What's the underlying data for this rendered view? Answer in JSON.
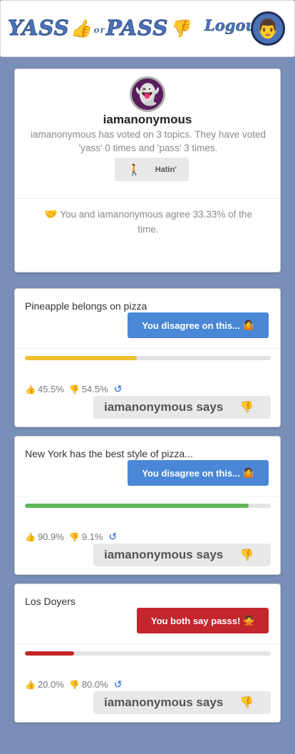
{
  "header": {
    "logo": {
      "part1": "YASS",
      "thumb_up": "👍",
      "or": "or",
      "part2": "PASS",
      "thumb_down": "👎"
    },
    "logout_label": "Logout",
    "avatar_emoji": "👨"
  },
  "profile": {
    "avatar_emoji": "👻",
    "username": "iamanonymous",
    "summary": "iamanonymous has voted on 3 topics. They have voted 'yass' 0 times and 'pass' 3 times.",
    "badge_emoji": "🚶",
    "badge_label": "Hatin'",
    "agreement_icon": "🤝",
    "agreement_text": "You and iamanonymous agree 33.33% of the time."
  },
  "topics": [
    {
      "title": "Pineapple belongs on pizza",
      "status_label": "You disagree on this...",
      "status_emoji": "🤷",
      "status_color": "#4a87d6",
      "yass_percent": "45.5%",
      "pass_percent": "54.5%",
      "yass_fraction": 0.455,
      "bar_color": "#f0bf2e",
      "says_label": "iamanonymous says",
      "says_vote_icon": "👎"
    },
    {
      "title": "New York has the best style of pizza...",
      "status_label": "You disagree on this...",
      "status_emoji": "🤷",
      "status_color": "#4a87d6",
      "yass_percent": "90.9%",
      "pass_percent": "9.1%",
      "yass_fraction": 0.909,
      "bar_color": "#5cb85c",
      "says_label": "iamanonymous says",
      "says_vote_icon": "👎"
    },
    {
      "title": "Los Doyers",
      "status_label": "You both say passs!",
      "status_emoji": "🙅",
      "status_color": "#c4262e",
      "yass_percent": "20.0%",
      "pass_percent": "80.0%",
      "yass_fraction": 0.2,
      "bar_color": "#c4262e",
      "says_label": "iamanonymous says",
      "says_vote_icon": "👎"
    }
  ],
  "icons": {
    "up": "👍",
    "down": "👎",
    "refresh": "↺"
  }
}
